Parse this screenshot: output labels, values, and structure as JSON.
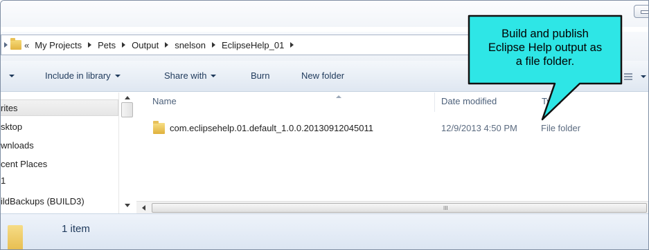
{
  "address": {
    "overflow_chevron": "«",
    "breadcrumbs": [
      "My Projects",
      "Pets",
      "Output",
      "snelson",
      "EclipseHelp_01"
    ]
  },
  "toolbar": {
    "include_in_library": "Include in library",
    "share_with": "Share with",
    "burn": "Burn",
    "new_folder": "New folder"
  },
  "nav": {
    "items": [
      "rites",
      "sktop",
      "wnloads",
      "cent Places",
      "1",
      "ildBackups (BUILD3)"
    ]
  },
  "columns": {
    "name": "Name",
    "date_modified": "Date modified",
    "type": "Type"
  },
  "files": [
    {
      "name": "com.eclipsehelp.01.default_1.0.0.20130912045011",
      "date_modified": "12/9/2013 4:50 PM",
      "type": "File folder"
    }
  ],
  "hscroll_grip": "III",
  "status": {
    "count": "1 item"
  },
  "callout": {
    "lines": [
      "Build and publish",
      "Eclipse Help output as",
      "a file folder."
    ],
    "fill": "#2ee6e6",
    "stroke": "#111111"
  }
}
